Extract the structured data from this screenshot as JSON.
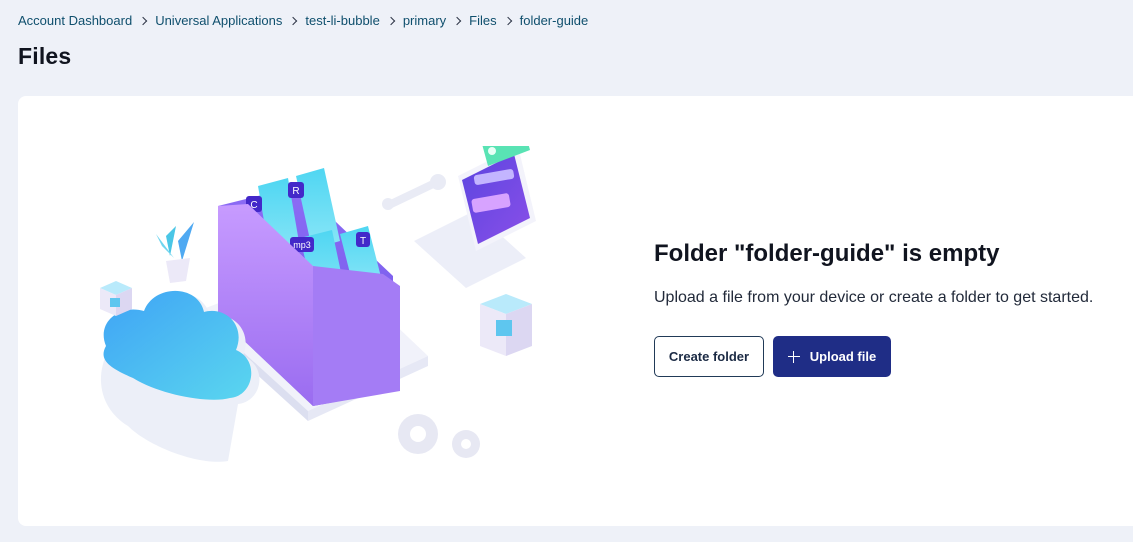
{
  "breadcrumb": {
    "items": [
      "Account Dashboard",
      "Universal Applications",
      "test-li-bubble",
      "primary",
      "Files",
      "folder-guide"
    ]
  },
  "page": {
    "title": "Files"
  },
  "empty_state": {
    "title": "Folder \"folder-guide\" is empty",
    "description": "Upload a file from your device or create a folder to get started.",
    "create_folder_label": "Create folder",
    "upload_file_label": "Upload file"
  },
  "illustration": {
    "file_tags": [
      "C",
      "R",
      "mp3",
      "T"
    ]
  },
  "colors": {
    "background": "#eef1f8",
    "link": "#0f4f6d",
    "primary_button": "#1f2d86",
    "folder": "#b488ff"
  }
}
